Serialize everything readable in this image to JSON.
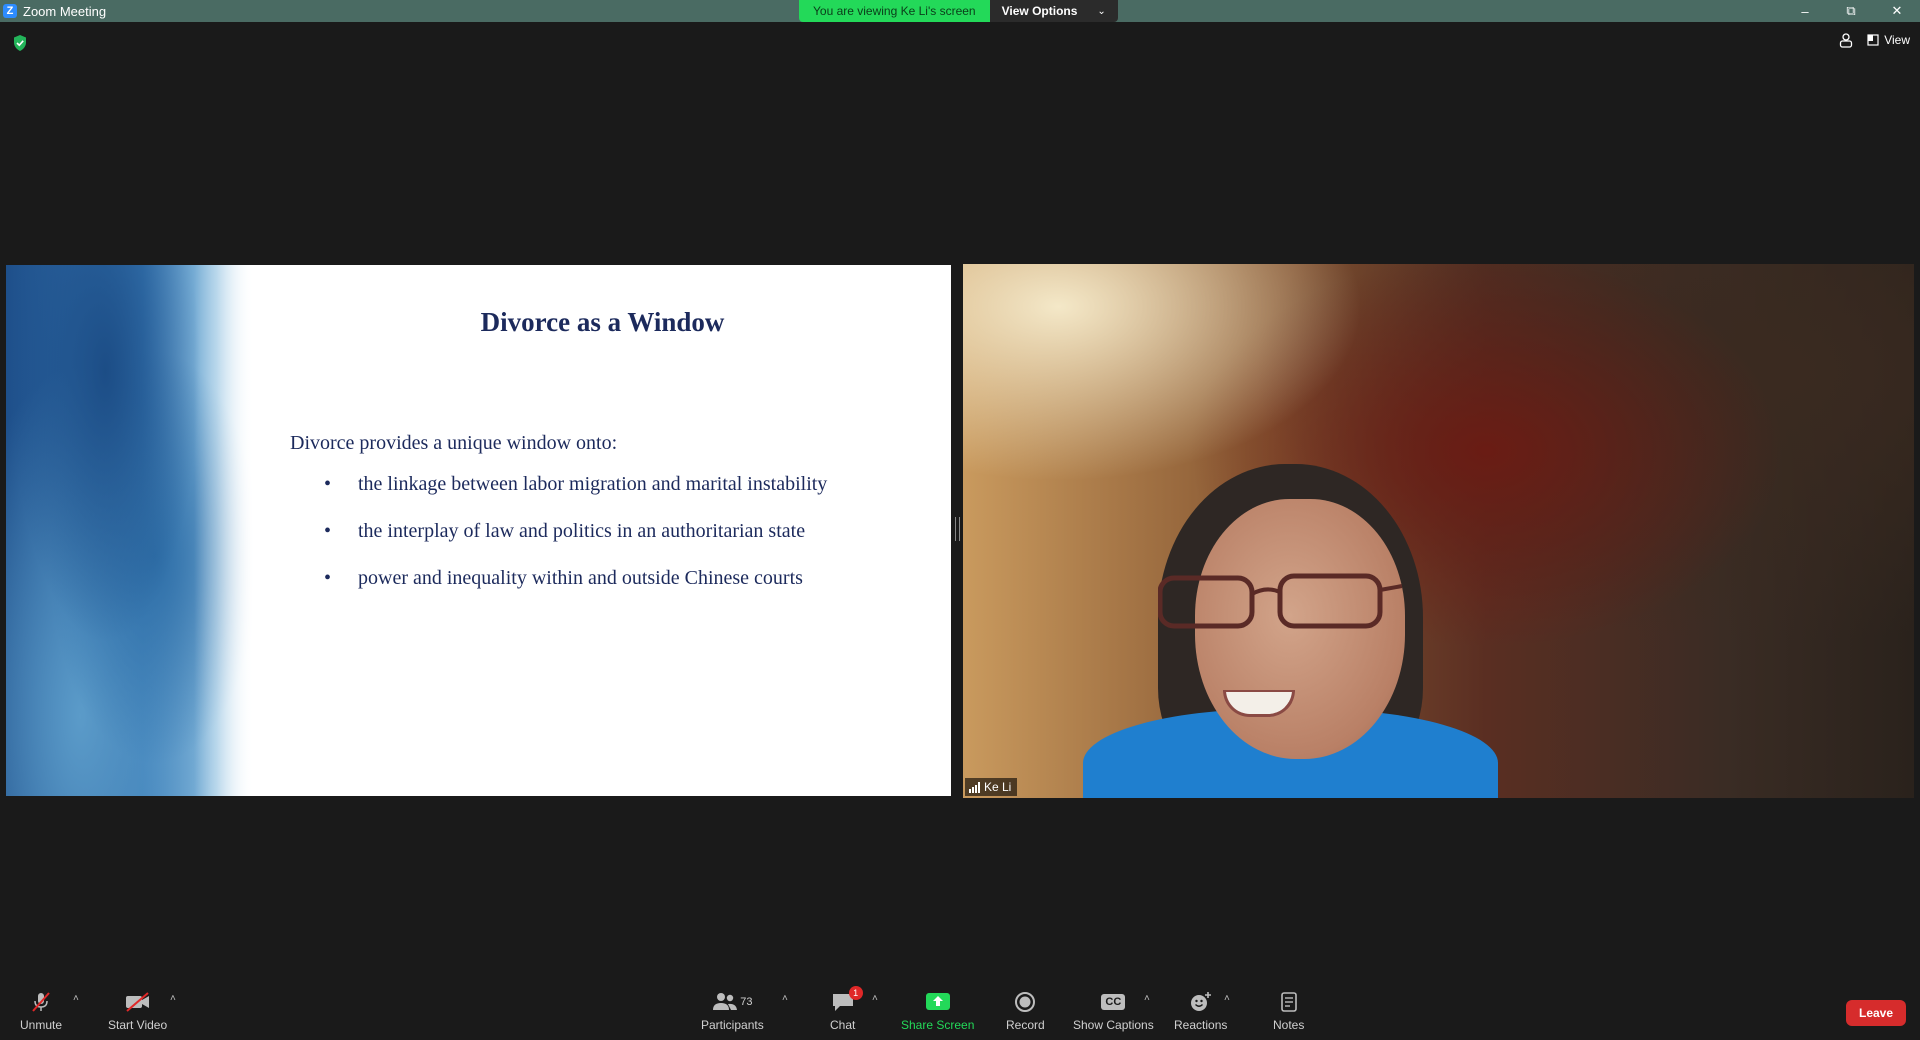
{
  "window": {
    "logo_letter": "Z",
    "title": "Zoom Meeting",
    "minimize_glyph": "–",
    "restore_glyph": "⧉",
    "close_glyph": "✕"
  },
  "share_banner": {
    "viewing_text": "You are viewing Ke Li's screen",
    "options_label": "View Options",
    "options_chevron": "⌄"
  },
  "top_right": {
    "view_label": "View"
  },
  "slide": {
    "title": "Divorce as a Window",
    "intro": "Divorce provides a unique window onto:",
    "bullet_glyph": "•",
    "bullets": [
      "the linkage between labor migration and marital instability",
      "the interplay of law and politics in an authoritarian state",
      "power and inequality within and outside Chinese courts"
    ]
  },
  "participant": {
    "name": "Ke Li"
  },
  "toolbar": {
    "caret": "˄",
    "unmute": "Unmute",
    "start_video": "Start Video",
    "participants": "Participants",
    "participants_count": "73",
    "chat": "Chat",
    "chat_badge": "1",
    "share_screen": "Share Screen",
    "record": "Record",
    "show_captions": "Show Captions",
    "cc_text": "CC",
    "reactions": "Reactions",
    "notes": "Notes",
    "leave": "Leave"
  },
  "colors": {
    "titlebar": "#4a6b63",
    "share_green": "#23d959",
    "leave_red": "#d62c2c",
    "slide_text": "#1c2a5c",
    "background": "#1a1a1a"
  }
}
